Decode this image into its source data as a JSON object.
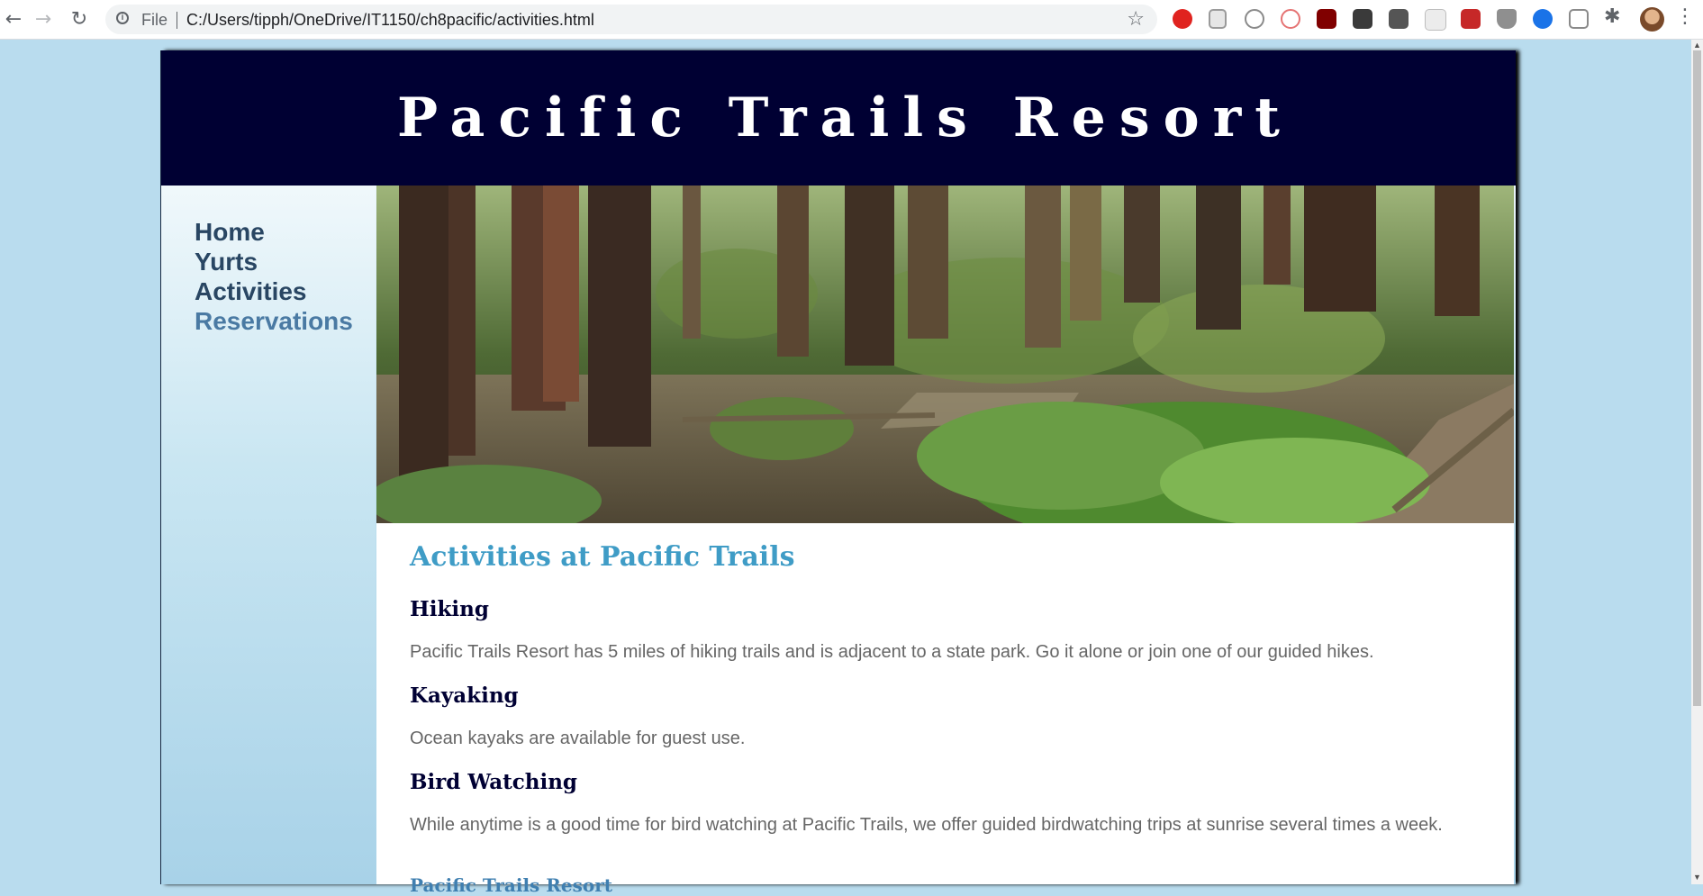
{
  "browser": {
    "scheme_label": "File",
    "url": "C:/Users/tipph/OneDrive/IT1150/ch8pacific/activities.html",
    "back_icon": "←",
    "forward_icon": "→",
    "reload_icon": "↻",
    "star_icon": "☆",
    "extensions_icon": "✱",
    "menu_icon": "⋮"
  },
  "page": {
    "site_title": "Pacific Trails Resort",
    "nav": [
      {
        "label": "Home"
      },
      {
        "label": "Yurts"
      },
      {
        "label": "Activities"
      },
      {
        "label": "Reservations"
      }
    ],
    "heading": "Activities at Pacific Trails",
    "sections": [
      {
        "title": "Hiking",
        "text": "Pacific Trails Resort has 5 miles of hiking trails and is adjacent to a state park. Go it alone or join one of our guided hikes."
      },
      {
        "title": "Kayaking",
        "text": "Ocean kayaks are available for guest use."
      },
      {
        "title": "Bird Watching",
        "text": "While anytime is a good time for bird watching at Pacific Trails, we offer guided birdwatching trips at sunrise several times a week."
      }
    ],
    "footer_partial": "Pacific Trails Resort"
  },
  "colors": {
    "header_bg": "#000033",
    "heading": "#3f9cc6",
    "page_bg": "#b9dcee"
  }
}
